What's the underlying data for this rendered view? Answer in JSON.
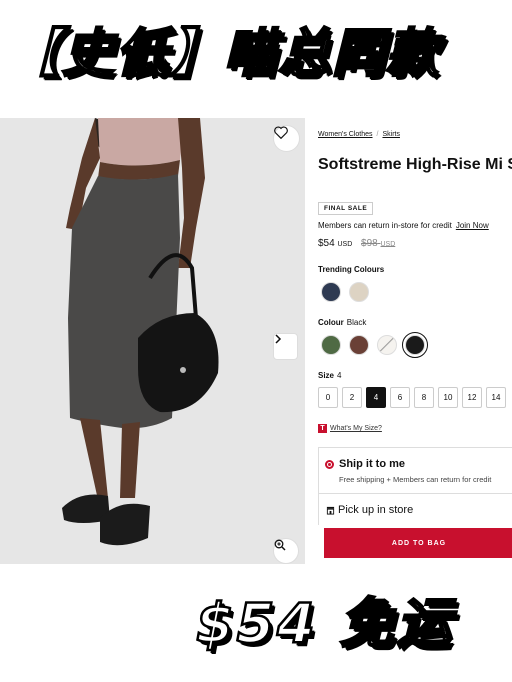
{
  "banner": {
    "title": "【史低】喵总同款",
    "promo": "$54 免运"
  },
  "breadcrumb": {
    "items": [
      "Women's Clothes",
      "Skirts"
    ],
    "separator": "/"
  },
  "product": {
    "title": "Softstreme High-Rise Mi Skirt",
    "badge": "FINAL SALE",
    "credit_note": "Members can return in-store for credit",
    "join_label": "Join Now",
    "price": "$54",
    "price_currency": "USD",
    "old_price": "$98",
    "old_currency": "USD"
  },
  "trending": {
    "label": "Trending Colours",
    "swatches": [
      {
        "name": "navy",
        "color": "#2e3a52"
      },
      {
        "name": "oatmeal",
        "color": "#ddd3c3"
      }
    ]
  },
  "colour": {
    "label": "Colour",
    "value": "Black",
    "swatches": [
      {
        "name": "olive",
        "color": "#4f6a44"
      },
      {
        "name": "mahogany",
        "color": "#6a4036"
      },
      {
        "name": "white-stripe",
        "color": "#f0eeea"
      },
      {
        "name": "black",
        "color": "#1a1a1a"
      }
    ]
  },
  "size": {
    "label": "Size",
    "value": "4",
    "options": [
      "0",
      "2",
      "4",
      "6",
      "8",
      "10",
      "12",
      "14"
    ],
    "guide_label": "What's My Size?",
    "guide_icon_letter": "T"
  },
  "shipping": {
    "ship_title": "Ship it to me",
    "ship_sub": "Free shipping + Members can return for credit",
    "pickup_title": "Pick up in store"
  },
  "cta": {
    "add_to_bag": "ADD TO BAG"
  },
  "icons": {
    "favorite": "heart-icon",
    "next": "chevron-right-icon",
    "zoom": "zoom-in-icon",
    "store": "store-icon"
  },
  "colors": {
    "accent": "#c8102e"
  }
}
